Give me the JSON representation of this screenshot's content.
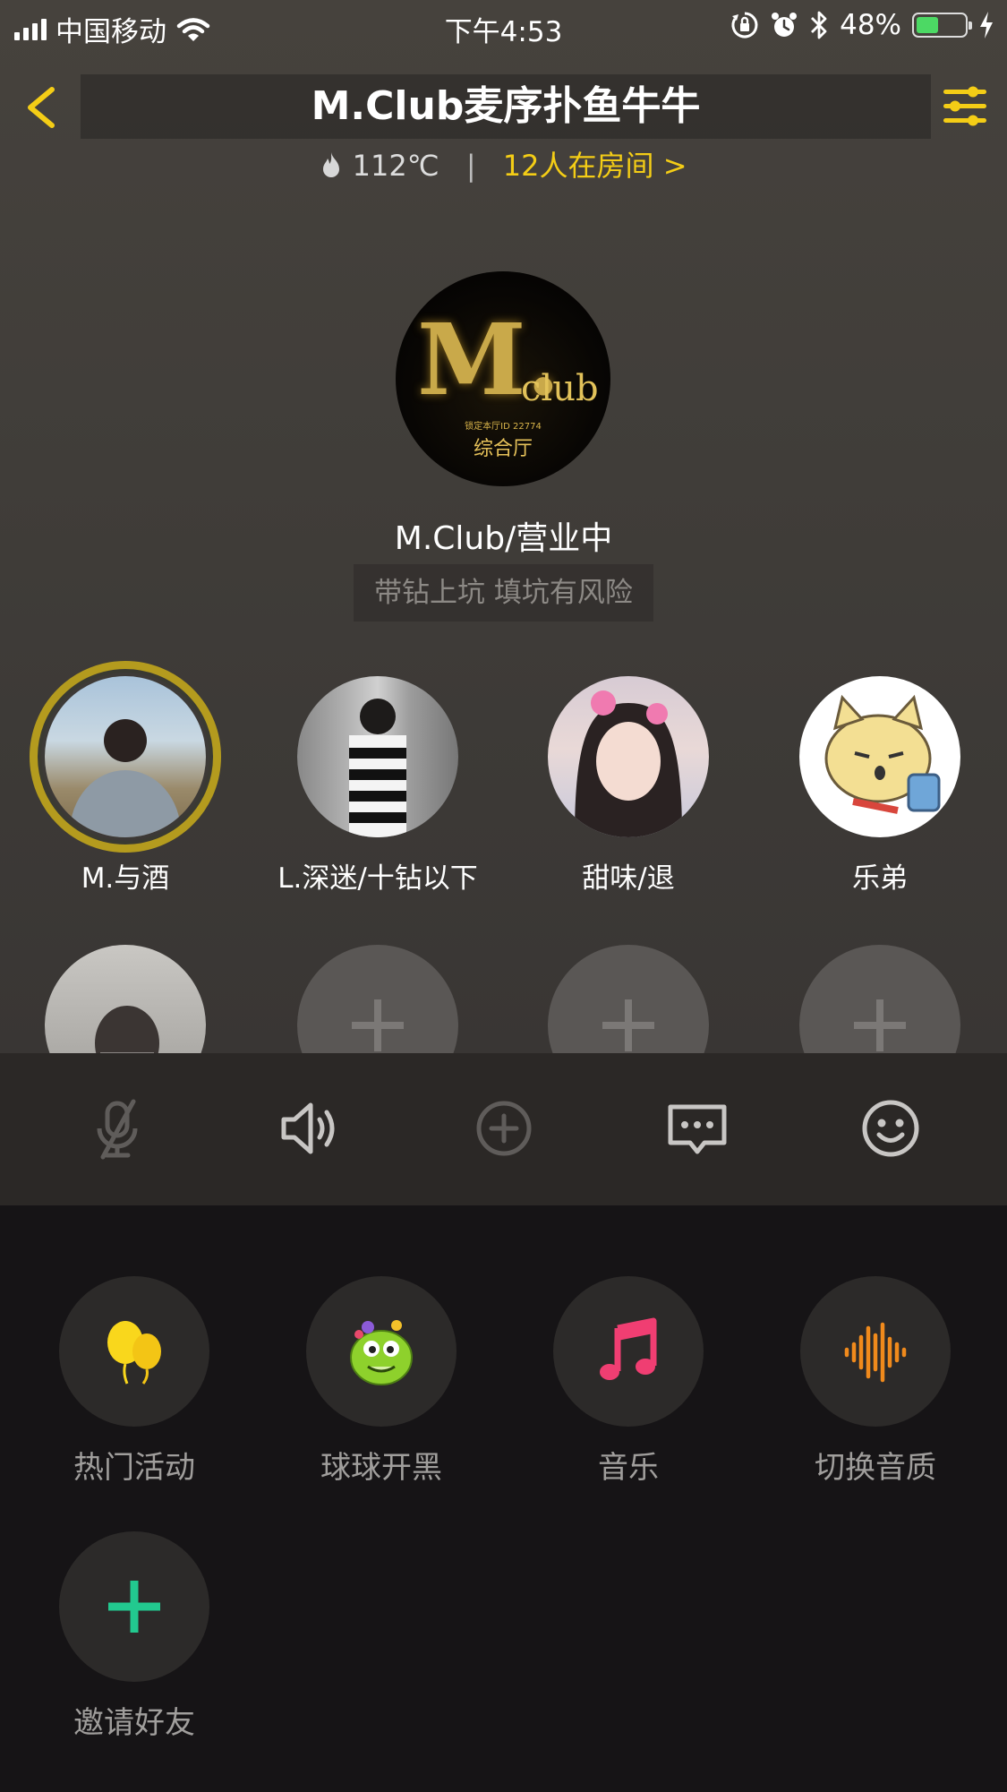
{
  "status_bar": {
    "carrier": "中国移动",
    "time": "下午4:53",
    "battery_percent": "48%",
    "battery_level": 0.48,
    "battery_color": "#4cd964"
  },
  "header": {
    "back_icon": "chevron-left-icon",
    "title": "M.Club麦序扑鱼牛牛",
    "settings_icon": "sliders-icon",
    "heat": "112℃",
    "separator": "|",
    "room_count": "12人在房间 >",
    "accent_color": "#f4cd16"
  },
  "host": {
    "logo_m": "M.",
    "logo_club": "club",
    "logo_id": "锁定本厅ID  22774",
    "logo_hall": "综合厅",
    "name": "M.Club/营业中",
    "tagline": "带钻上坑 填坑有风险"
  },
  "seats": [
    {
      "name": "M.与酒",
      "speaking": true
    },
    {
      "name": "L.深迷/十钻以下",
      "speaking": false
    },
    {
      "name": "甜味/退",
      "speaking": false
    },
    {
      "name": "乐弟",
      "speaking": false
    }
  ],
  "toolbar": {
    "mic": "mic-muted-icon",
    "speaker": "speaker-icon",
    "add": "plus-circle-icon",
    "chat": "chat-bubble-icon",
    "emoji": "smiley-icon"
  },
  "functions": [
    {
      "label": "热门活动",
      "icon": "balloons-icon"
    },
    {
      "label": "球球开黑",
      "icon": "monster-icon"
    },
    {
      "label": "音乐",
      "icon": "music-note-icon"
    },
    {
      "label": "切换音质",
      "icon": "sound-wave-icon"
    },
    {
      "label": "邀请好友",
      "icon": "plus-icon"
    }
  ]
}
